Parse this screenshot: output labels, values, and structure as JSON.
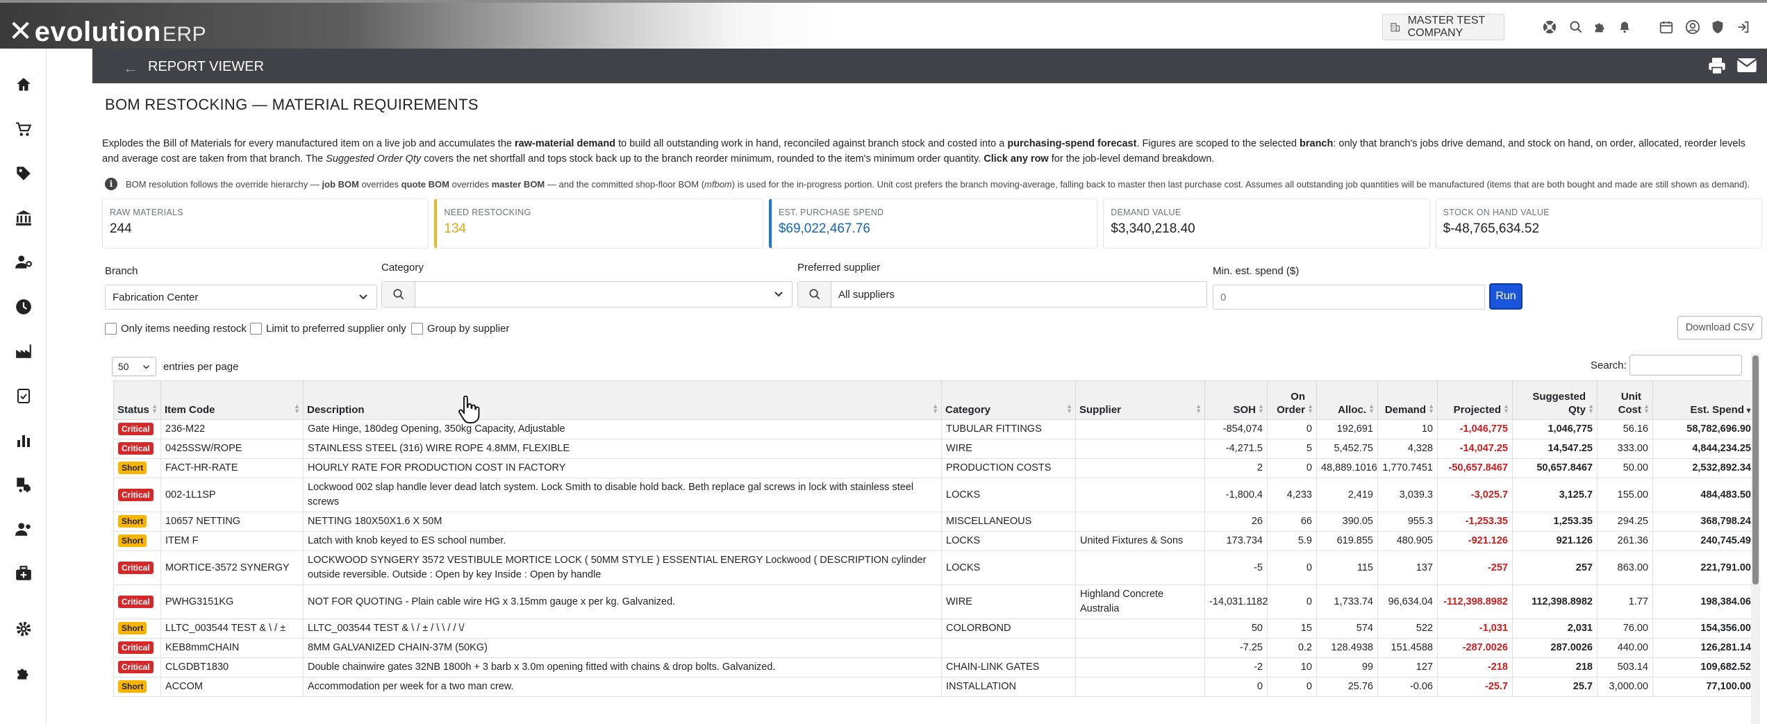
{
  "brand": {
    "name": "evolution",
    "suffix": "ERP"
  },
  "header": {
    "company": "MASTER TEST COMPANY",
    "icons": [
      "building-icon",
      "lifebuoy-icon",
      "search-icon",
      "puzzle-icon",
      "bell-icon",
      "calendar-icon",
      "user-circle-icon",
      "shield-icon",
      "logout-icon"
    ]
  },
  "sidebar": [
    "home-icon",
    "cart-icon",
    "tag-icon",
    "bank-icon",
    "user-cog-icon",
    "clock-icon",
    "factory-icon",
    "clipboard-check-icon",
    "bar-chart-icon",
    "truck-building-icon",
    "users-icon",
    "medical-case-icon",
    "gear-icon",
    "puzzle-icon"
  ],
  "viewer": {
    "back": "←",
    "title": "REPORT VIEWER"
  },
  "page": {
    "title": "BOM RESTOCKING — MATERIAL REQUIREMENTS",
    "desc": [
      {
        "t": "Explodes the Bill of Materials for every manufactured item on a live job and accumulates the "
      },
      {
        "t": "raw-material demand",
        "b": true
      },
      {
        "t": " to build all outstanding work in hand, reconciled against branch stock and costed into a "
      },
      {
        "t": "purchasing-spend forecast",
        "b": true
      },
      {
        "t": ". Figures are scoped to the selected "
      },
      {
        "t": "branch",
        "b": true
      },
      {
        "t": ": only that branch's jobs drive demand, and stock on hand, on order, allocated, reorder levels and average cost are taken from that branch. The "
      },
      {
        "t": "Suggested Order Qty",
        "i": true
      },
      {
        "t": " covers the net shortfall and tops stock back up to the branch reorder minimum, rounded to the item's minimum order quantity. "
      },
      {
        "t": "Click any row",
        "b": true
      },
      {
        "t": " for the job-level demand breakdown."
      }
    ],
    "note": [
      {
        "t": "BOM resolution follows the override hierarchy — "
      },
      {
        "t": "job BOM",
        "b": true
      },
      {
        "t": " overrides "
      },
      {
        "t": "quote BOM",
        "b": true
      },
      {
        "t": " overrides "
      },
      {
        "t": "master BOM",
        "b": true
      },
      {
        "t": " — and the committed shop-floor BOM ("
      },
      {
        "t": "mfbom",
        "i": true
      },
      {
        "t": ") is used for the in-progress portion. Unit cost prefers the branch moving-average, falling back to master then last purchase cost. Assumes all outstanding job quantities will be manufactured (items that are both bought and made are still shown as demand)."
      }
    ]
  },
  "stats": [
    {
      "label": "RAW MATERIALS",
      "value": "244",
      "style": ""
    },
    {
      "label": "NEED RESTOCKING",
      "value": "134",
      "style": "warn"
    },
    {
      "label": "EST. PURCHASE SPEND",
      "value": "$69,022,467.76",
      "style": "prim"
    },
    {
      "label": "DEMAND VALUE",
      "value": "$3,340,218.40",
      "style": ""
    },
    {
      "label": "STOCK ON HAND VALUE",
      "value": "$-48,765,634.52",
      "style": ""
    }
  ],
  "filters": {
    "branch_label": "Branch",
    "branch_value": "Fabrication Center",
    "category_label": "Category",
    "category_value": "",
    "supplier_label": "Preferred supplier",
    "supplier_value": "All suppliers",
    "minspend_label": "Min. est. spend ($)",
    "minspend_placeholder": "0",
    "run": "Run",
    "csv": "Download CSV",
    "checks": [
      "Only items needing restock",
      "Limit to preferred supplier only",
      "Group by supplier"
    ]
  },
  "table": {
    "per_page": "50",
    "per_page_label": "entries per page",
    "search_label": "Search:",
    "columns": [
      "Status",
      "Item Code",
      "Description",
      "Category",
      "Supplier",
      "SOH",
      "On Order",
      "Alloc.",
      "Demand",
      "Projected",
      "Suggested Qty",
      "Unit Cost",
      "Est. Spend"
    ],
    "rows": [
      [
        "Critical",
        "236-M22",
        "Gate Hinge, 180deg Opening, 350kg Capacity, Adjustable",
        "TUBULAR FITTINGS",
        "",
        "-854,074",
        "0",
        "192,691",
        "10",
        "-1,046,775",
        "1,046,775",
        "56.16",
        "58,782,696.90"
      ],
      [
        "Critical",
        "0425SSW/ROPE",
        "STAINLESS STEEL (316) WIRE ROPE 4.8MM, FLEXIBLE",
        "WIRE",
        "",
        "-4,271.5",
        "5",
        "5,452.75",
        "4,328",
        "-14,047.25",
        "14,547.25",
        "333.00",
        "4,844,234.25"
      ],
      [
        "Short",
        "FACT-HR-RATE",
        "HOURLY RATE FOR PRODUCTION COST IN FACTORY",
        "PRODUCTION COSTS",
        "",
        "2",
        "0",
        "48,889.1016",
        "1,770.7451",
        "-50,657.8467",
        "50,657.8467",
        "50.00",
        "2,532,892.34"
      ],
      [
        "Critical",
        "002-1L1SP",
        "Lockwood 002 slap handle lever dead latch system. Lock Smith to disable hold back. Beth replace gal screws in lock with stainless steel screws",
        "LOCKS",
        "",
        "-1,800.4",
        "4,233",
        "2,419",
        "3,039.3",
        "-3,025.7",
        "3,125.7",
        "155.00",
        "484,483.50"
      ],
      [
        "Short",
        "10657 NETTING",
        "NETTING 180X50X1.6 X 50M",
        "MISCELLANEOUS",
        "",
        "26",
        "66",
        "390.05",
        "955.3",
        "-1,253.35",
        "1,253.35",
        "294.25",
        "368,798.24"
      ],
      [
        "Short",
        "ITEM F",
        "Latch with knob keyed to ES school number.",
        "LOCKS",
        "United Fixtures & Sons",
        "173.734",
        "5.9",
        "619.855",
        "480.905",
        "-921.126",
        "921.126",
        "261.36",
        "240,745.49"
      ],
      [
        "Critical",
        "MORTICE-3572 SYNERGY",
        "LOCKWOOD SYNGERY 3572 VESTIBULE MORTICE LOCK ( 50MM STYLE ) ESSENTIAL ENERGY Lockwood ( DESCRIPTION cylinder outside reversible. Outside : Open by key Inside : Open by handle",
        "LOCKS",
        "",
        "-5",
        "0",
        "115",
        "137",
        "-257",
        "257",
        "863.00",
        "221,791.00"
      ],
      [
        "Critical",
        "PWHG3151KG",
        "NOT FOR QUOTING - Plain cable wire HG x 3.15mm gauge x per kg. Galvanized.",
        "WIRE",
        "Highland Concrete Australia",
        "-14,031.1182",
        "0",
        "1,733.74",
        "96,634.04",
        "-112,398.8982",
        "112,398.8982",
        "1.77",
        "198,384.06"
      ],
      [
        "Short",
        "LLTC_003544 TEST & \\ / ±",
        "LLTC_003544 TEST & \\ / ± / \\ \\ / / \\/",
        "COLORBOND",
        "",
        "50",
        "15",
        "574",
        "522",
        "-1,031",
        "2,031",
        "76.00",
        "154,356.00"
      ],
      [
        "Critical",
        "KEB8mmCHAIN",
        "8MM GALVANIZED CHAIN-37M (50KG)",
        "",
        "",
        "-7.25",
        "0.2",
        "128.4938",
        "151.4588",
        "-287.0026",
        "287.0026",
        "440.00",
        "126,281.14"
      ],
      [
        "Critical",
        "CLGDBT1830",
        "Double chainwire gates 32NB 1800h + 3 barb x 3.0m opening fitted with chains & drop bolts. Galvanized.",
        "CHAIN-LINK GATES",
        "",
        "-2",
        "10",
        "99",
        "127",
        "-218",
        "218",
        "503.14",
        "109,682.52"
      ],
      [
        "Short",
        "ACCOM",
        "Accommodation per week for a two man crew.",
        "INSTALLATION",
        "",
        "0",
        "0",
        "25.76",
        "-0.06",
        "-25.7",
        "25.7",
        "3,000.00",
        "77,100.00"
      ]
    ]
  }
}
